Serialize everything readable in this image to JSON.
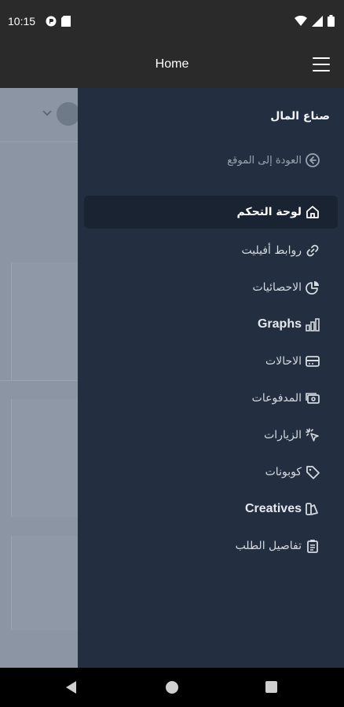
{
  "status_bar": {
    "time": "10:15",
    "left_icons": [
      "pocket-icon",
      "sim-card-icon"
    ],
    "right_icons": [
      "wifi-icon",
      "signal-icon",
      "battery-icon"
    ]
  },
  "app_bar": {
    "title": "Home",
    "menu_icon": "hamburger-menu-icon"
  },
  "drawer": {
    "brand": "صناع المال",
    "back_link": "العودة إلى الموقع",
    "items": [
      {
        "label": "لوحة التحكم",
        "icon": "home-icon",
        "active": true
      },
      {
        "label": "روابط أفيليت",
        "icon": "link-icon",
        "active": false
      },
      {
        "label": "الاحصائيات",
        "icon": "pie-chart-icon",
        "active": false
      },
      {
        "label": "Graphs",
        "icon": "bar-chart-icon",
        "active": false
      },
      {
        "label": "الاحالات",
        "icon": "credit-card-icon",
        "active": false
      },
      {
        "label": "المدفوعات",
        "icon": "cash-icon",
        "active": false
      },
      {
        "label": "الزيارات",
        "icon": "cursor-click-icon",
        "active": false
      },
      {
        "label": "كوبونات",
        "icon": "tag-icon",
        "active": false
      },
      {
        "label": "Creatives",
        "icon": "palette-icon",
        "active": false
      },
      {
        "label": "تفاصيل الطلب",
        "icon": "clipboard-icon",
        "active": false
      }
    ]
  },
  "system_nav": {
    "back": "back-icon",
    "home": "home-circle-icon",
    "recents": "recents-icon"
  },
  "colors": {
    "drawer_bg": "#232f40",
    "active_bg": "#1a2331",
    "app_bar_bg": "#2a2a2a",
    "scrim": "#8b95a4"
  }
}
